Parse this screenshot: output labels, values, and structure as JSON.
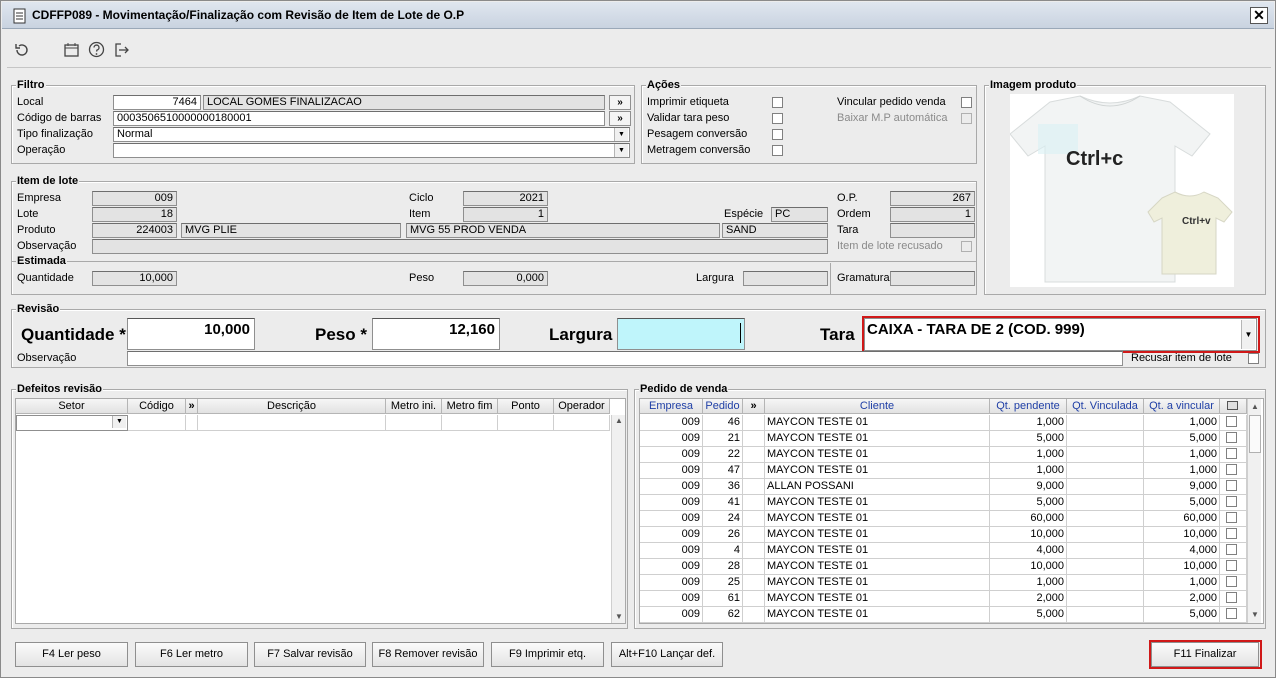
{
  "window": {
    "title": "CDFFP089 - Movimentação/Finalização com Revisão de Item de Lote de O.P",
    "close_label": "✕"
  },
  "toolbar": {
    "icons": [
      "refresh-icon",
      "calendar-icon",
      "help-icon",
      "exit-icon"
    ]
  },
  "filtro": {
    "title": "Filtro",
    "local_label": "Local",
    "local_code": "7464",
    "local_name": "LOCAL GOMES FINALIZACAO",
    "barcode_label": "Código de barras",
    "barcode_value": "0003506510000000180001",
    "tipo_label": "Tipo finalização",
    "tipo_value": "Normal",
    "operacao_label": "Operação",
    "operacao_value": "",
    "lookup": "»"
  },
  "acoes": {
    "title": "Ações",
    "imprimir": "Imprimir etiqueta",
    "validar": "Validar tara peso",
    "pesagem": "Pesagem conversão",
    "metragem": "Metragem conversão",
    "vincular": "Vincular pedido venda",
    "baixar": "Baixar M.P automática"
  },
  "imagem": {
    "title": "Imagem produto",
    "text_big": "Ctrl+c",
    "text_small": "Ctrl+v"
  },
  "item_lote": {
    "title": "Item de lote",
    "empresa_label": "Empresa",
    "empresa": "009",
    "lote_label": "Lote",
    "lote": "18",
    "produto_label": "Produto",
    "produto_code": "224003",
    "produto_name": "MVG PLIE",
    "obs_label": "Observação",
    "ciclo_label": "Ciclo",
    "ciclo": "2021",
    "item_label": "Item",
    "item": "1",
    "produto_desc": "MVG 55 PROD VENDA",
    "especie_label": "Espécie",
    "especie": "PC",
    "cor": "SAND",
    "op_label": "O.P.",
    "op": "267",
    "ordem_label": "Ordem",
    "ordem": "1",
    "tara_label": "Tara",
    "recusado_label": "Item de lote recusado"
  },
  "estimada": {
    "title": "Estimada",
    "quantidade_label": "Quantidade",
    "quantidade": "10,000",
    "peso_label": "Peso",
    "peso": "0,000",
    "largura_label": "Largura",
    "gramatura_label": "Gramatura"
  },
  "revisao": {
    "title": "Revisão",
    "quantidade_label": "Quantidade *",
    "quantidade": "10,000",
    "peso_label": "Peso *",
    "peso": "12,160",
    "largura_label": "Largura",
    "tara_label": "Tara",
    "tara_value": "CAIXA - TARA DE 2 (COD. 999)",
    "obs_label": "Observação",
    "recusar_label": "Recusar item de lote"
  },
  "defeitos": {
    "title": "Defeitos revisão",
    "columns": [
      "Setor",
      "Código",
      "»",
      "Descrição",
      "Metro ini.",
      "Metro fim",
      "Ponto",
      "Operador"
    ]
  },
  "pedido": {
    "title": "Pedido de venda",
    "columns": [
      "Empresa",
      "Pedido",
      "»",
      "Cliente",
      "Qt. pendente",
      "Qt. Vinculada",
      "Qt. a vincular"
    ],
    "rows": [
      {
        "empresa": "009",
        "pedido": "46",
        "cliente": "MAYCON TESTE 01",
        "pendente": "1,000",
        "vinculada": "",
        "vincular": "1,000"
      },
      {
        "empresa": "009",
        "pedido": "21",
        "cliente": "MAYCON TESTE 01",
        "pendente": "5,000",
        "vinculada": "",
        "vincular": "5,000"
      },
      {
        "empresa": "009",
        "pedido": "22",
        "cliente": "MAYCON TESTE 01",
        "pendente": "1,000",
        "vinculada": "",
        "vincular": "1,000"
      },
      {
        "empresa": "009",
        "pedido": "47",
        "cliente": "MAYCON TESTE 01",
        "pendente": "1,000",
        "vinculada": "",
        "vincular": "1,000"
      },
      {
        "empresa": "009",
        "pedido": "36",
        "cliente": "ALLAN POSSANI",
        "pendente": "9,000",
        "vinculada": "",
        "vincular": "9,000"
      },
      {
        "empresa": "009",
        "pedido": "41",
        "cliente": "MAYCON TESTE 01",
        "pendente": "5,000",
        "vinculada": "",
        "vincular": "5,000"
      },
      {
        "empresa": "009",
        "pedido": "24",
        "cliente": "MAYCON TESTE 01",
        "pendente": "60,000",
        "vinculada": "",
        "vincular": "60,000"
      },
      {
        "empresa": "009",
        "pedido": "26",
        "cliente": "MAYCON TESTE 01",
        "pendente": "10,000",
        "vinculada": "",
        "vincular": "10,000"
      },
      {
        "empresa": "009",
        "pedido": "4",
        "cliente": "MAYCON TESTE 01",
        "pendente": "4,000",
        "vinculada": "",
        "vincular": "4,000"
      },
      {
        "empresa": "009",
        "pedido": "28",
        "cliente": "MAYCON TESTE 01",
        "pendente": "10,000",
        "vinculada": "",
        "vincular": "10,000"
      },
      {
        "empresa": "009",
        "pedido": "25",
        "cliente": "MAYCON TESTE 01",
        "pendente": "1,000",
        "vinculada": "",
        "vincular": "1,000"
      },
      {
        "empresa": "009",
        "pedido": "61",
        "cliente": "MAYCON TESTE 01",
        "pendente": "2,000",
        "vinculada": "",
        "vincular": "2,000"
      },
      {
        "empresa": "009",
        "pedido": "62",
        "cliente": "MAYCON TESTE 01",
        "pendente": "5,000",
        "vinculada": "",
        "vincular": "5,000"
      }
    ]
  },
  "buttons": {
    "f4": "F4 Ler peso",
    "f6": "F6 Ler metro",
    "f7": "F7 Salvar revisão",
    "f8": "F8 Remover revisão",
    "f9": "F9 Imprimir etq.",
    "f10": "Alt+F10 Lançar def.",
    "f11": "F11 Finalizar"
  },
  "colors": {
    "highlight_red": "#d01818",
    "largura_bg": "#bff5fb",
    "header_blue": "#1f3fa6"
  }
}
